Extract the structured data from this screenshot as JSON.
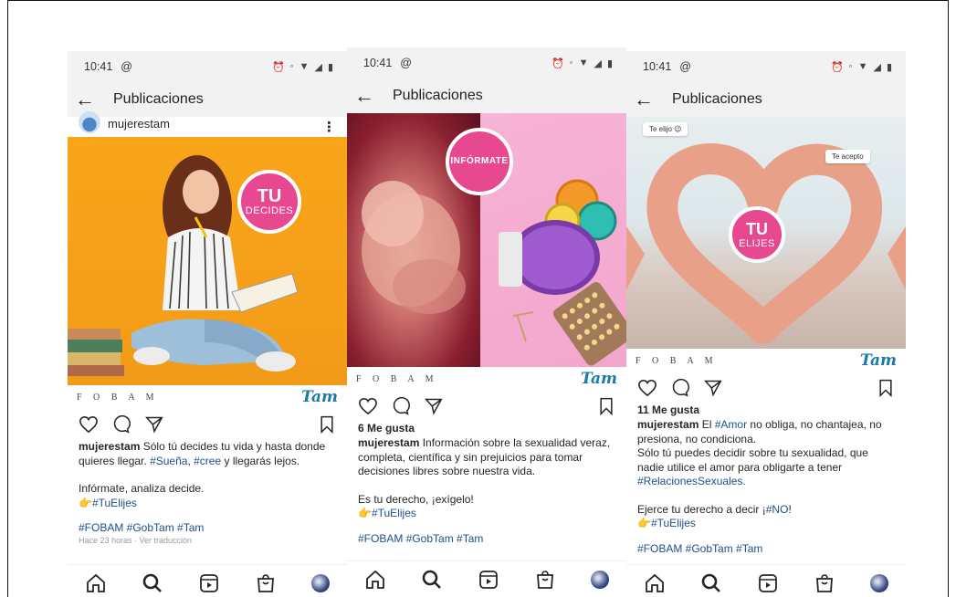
{
  "phones": [
    {
      "status_time": "10:41",
      "appbar_title": "Publicaciones",
      "username": "mujerestam",
      "badge_line1": "TU",
      "badge_line2": "DECIDES",
      "brand_left": "F O B A M",
      "brand_right": "Tam",
      "likes": "",
      "caption_user": "mujerestam",
      "caption_text": "Sólo tú decides tu vida y hasta donde quieres llegar.",
      "caption_tag1": "#Sueña",
      "caption_tag2": "#cree",
      "caption_tail": "y llegarás lejos.",
      "line2": "Infórmate, analiza decide.",
      "line3_tag": "#TuElijes",
      "hashtags": "#FOBAM #GobTam #Tam",
      "hint": "Hace 23 horas · Ver traducción"
    },
    {
      "status_time": "10:41",
      "appbar_title": "Publicaciones",
      "badge_line1": "INFÓRMATE",
      "brand_left": "F O B A M",
      "brand_right": "Tam",
      "likes": "6 Me gusta",
      "caption_user": "mujerestam",
      "caption_text": "Información sobre la sexualidad veraz, completa, científica y sin prejuicios para tomar decisiones libres sobre nuestra vida.",
      "line2": "Es tu derecho, ¡exígelo!",
      "line3_tag": "#TuElijes",
      "hashtags": "#FOBAM #GobTam #Tam"
    },
    {
      "status_time": "10:41",
      "appbar_title": "Publicaciones",
      "sticker_left": "Te elijo 😉",
      "sticker_right": "Te acepto",
      "badge_line1": "TU",
      "badge_line2": "ELIJES",
      "brand_left": "F O B A M",
      "brand_right": "Tam",
      "likes": "11 Me gusta",
      "caption_user": "mujerestam",
      "caption_pre": "El",
      "caption_tag1": "#Amor",
      "caption_text": "no obliga, no chantajea, no presiona, no condiciona.",
      "caption_text2": "Sólo tú puedes decidir sobre tu sexualidad, que nadie utilice el amor para obligarte a tener",
      "caption_tag2": "#RelacionesSexuales.",
      "line2_pre": "Ejerce tu derecho a decir ¡",
      "line2_tag": "#NO",
      "line2_post": "!",
      "line3_tag": "#TuElijes",
      "hashtags": "#FOBAM #GobTam #Tam"
    }
  ],
  "icons": {
    "back": "arrow-left-icon",
    "like": "heart-icon",
    "comment": "comment-icon",
    "share": "send-icon",
    "save": "bookmark-icon",
    "nav": [
      "home-icon",
      "search-icon",
      "reels-icon",
      "shop-icon",
      "profile-avatar"
    ]
  },
  "colors": {
    "badge_pink": "#e8488f",
    "tag_blue": "#1d4f8a",
    "img1_bg": "#f8a51a",
    "img2_right_bg": "#f6b4d6"
  }
}
